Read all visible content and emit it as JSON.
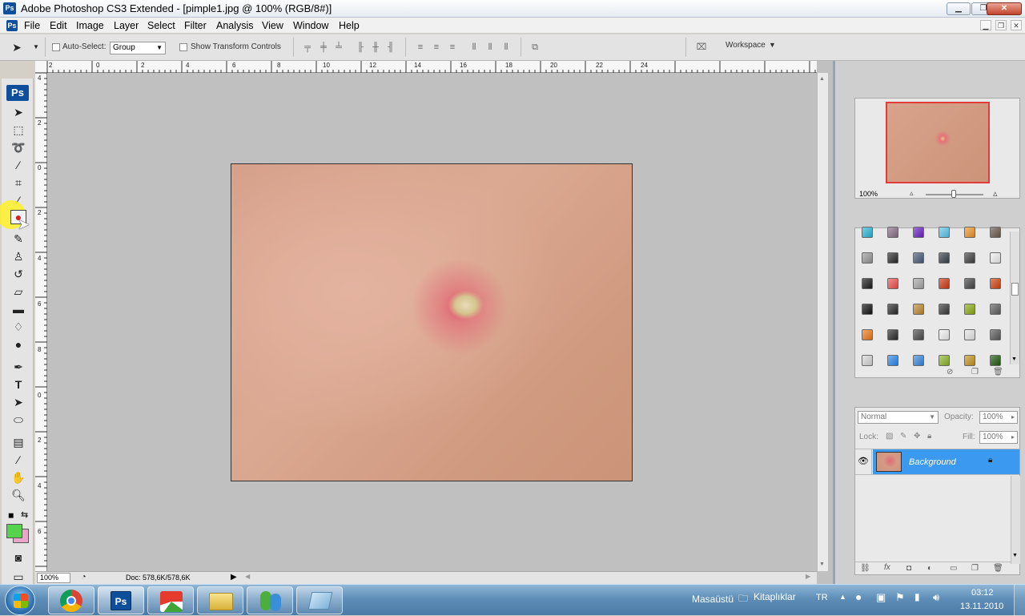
{
  "window": {
    "title": "Adobe Photoshop CS3 Extended - [pimple1.jpg @ 100% (RGB/8#)]",
    "app_badge": "Ps"
  },
  "menu": [
    "File",
    "Edit",
    "Image",
    "Layer",
    "Select",
    "Filter",
    "Analysis",
    "View",
    "Window",
    "Help"
  ],
  "options": {
    "auto_select_label": "Auto-Select:",
    "auto_select_value": "Group",
    "show_transform_label": "Show Transform Controls",
    "workspace_label": "Workspace"
  },
  "tools": {
    "badge": "Ps",
    "foreground_color": "#55d34d",
    "background_color": "#e8a7c8",
    "active_tool": "spot-healing-brush-icon"
  },
  "rulers": {
    "top": [
      "2",
      "0",
      "2",
      "4",
      "6",
      "8",
      "10",
      "12",
      "14",
      "16",
      "18",
      "20",
      "22",
      "24"
    ],
    "left": [
      "4",
      "2",
      "0",
      "2",
      "4",
      "6",
      "8",
      "0",
      "2",
      "4",
      "6"
    ]
  },
  "statusbar": {
    "zoom": "100%",
    "doc_info": "Doc: 578,6K/578,6K"
  },
  "navigator": {
    "zoom": "100%"
  },
  "layers": {
    "blend_mode": "Normal",
    "opacity_label": "Opacity:",
    "opacity_value": "100%",
    "lock_label": "Lock:",
    "fill_label": "Fill:",
    "fill_value": "100%",
    "layer_name": "Background"
  },
  "swatch_colors": [
    [
      "#2bb9d9",
      "#8a6f89",
      "#6a22c8",
      "#5ec6ee",
      "#f0962a",
      "#6a5a4e"
    ],
    [
      "#9a9a9a",
      "#2a2a2a",
      "#4a5a78",
      "#3a3f48",
      "#404040",
      "#f1f1f1"
    ],
    [
      "#1a1a1a",
      "#f25050",
      "#a8a8a8",
      "#d03a12",
      "#454545",
      "#d4430e"
    ],
    [
      "#101010",
      "#2a2a2a",
      "#c08a30",
      "#3a3a3a",
      "#8fae12",
      "#606060"
    ],
    [
      "#f07a1a",
      "#2b2b2b",
      "#4a4a4a",
      "#f2f2f2",
      "#e8e8e8",
      "#5a5a5a"
    ],
    [
      "#d8d8d8",
      "#2a8af0",
      "#3a8ae0",
      "#8db82a",
      "#c8961e",
      "#1f5a10"
    ]
  ],
  "taskbar": {
    "desktop_label": "Masaüstü",
    "libraries_label": "Kitaplıklar",
    "language": "TR",
    "time": "03:12",
    "date": "13.11.2010"
  }
}
